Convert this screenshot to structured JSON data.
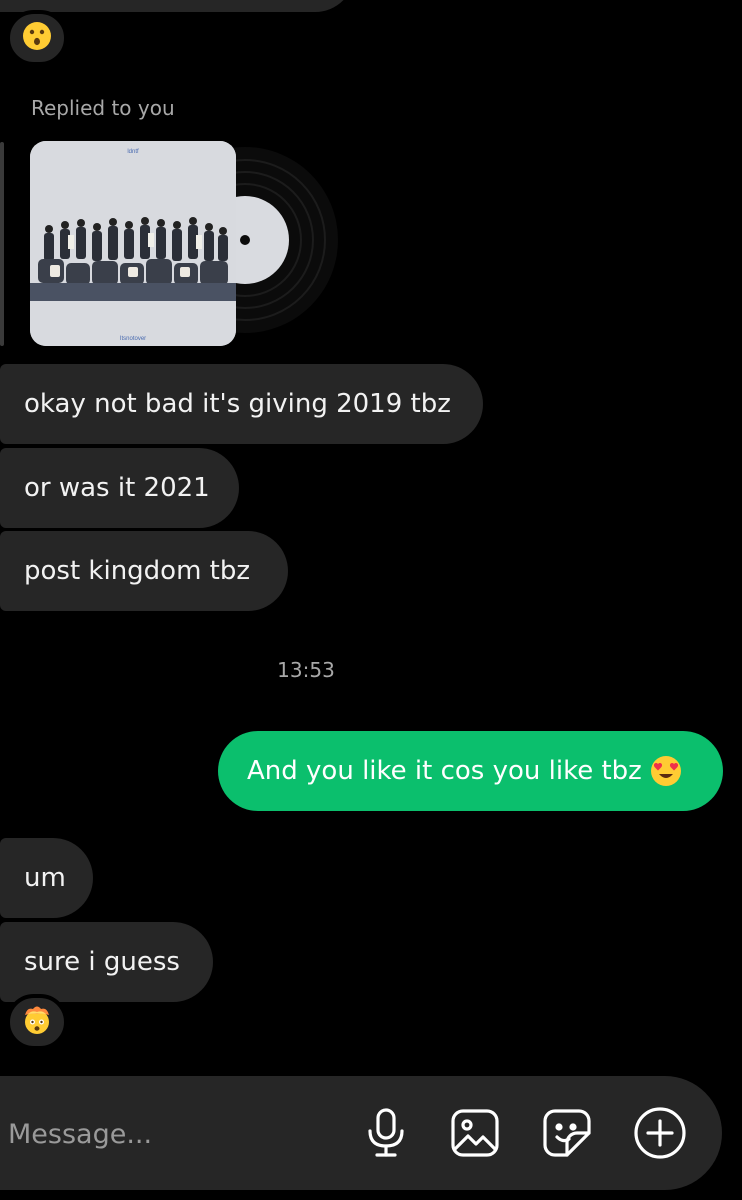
{
  "thread": {
    "reply_label": "Replied to you",
    "album": {
      "cover_top_text": "ldntf",
      "cover_bottom_text": "Itsnotover"
    },
    "incoming_messages_1": [
      "okay not bad it's giving 2019 tbz",
      "or was it 2021",
      "post kingdom tbz"
    ],
    "timestamp": "13:53",
    "outgoing_message": {
      "text": "And you like it cos you like tbz",
      "emoji_icon": "heart-eyes-emoji-icon"
    },
    "incoming_messages_2": [
      "um",
      "sure i guess"
    ],
    "reactions": {
      "top": "hushed-face-emoji-icon",
      "bottom": "exploding-head-emoji-icon"
    }
  },
  "composer": {
    "placeholder": "Message...",
    "icons": [
      "microphone-icon",
      "gallery-icon",
      "sticker-icon",
      "add-icon"
    ]
  },
  "colors": {
    "background": "#000000",
    "bubble": "#262626",
    "sent_bubble": "#0bbf6d",
    "secondary_text": "#a8a8a8"
  }
}
